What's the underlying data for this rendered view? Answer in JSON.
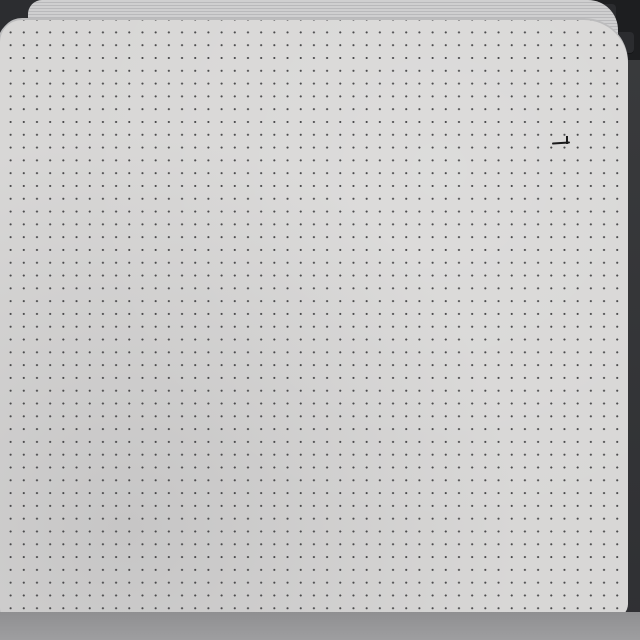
{
  "scene": {
    "subject": "dot-grid-notebook-page",
    "colors": {
      "paper": "#d8d7d6",
      "dots": "#3b3b3d",
      "background": "#2f3033",
      "keyboard": "#1d1e20"
    }
  }
}
